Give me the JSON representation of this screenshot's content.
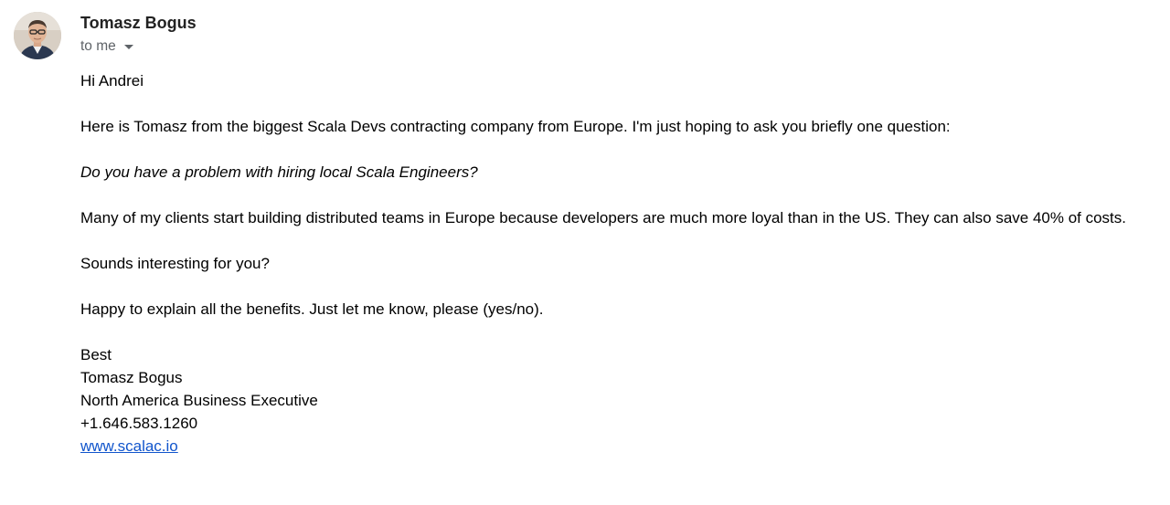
{
  "email": {
    "sender": {
      "name": "Tomasz Bogus",
      "avatar_icon": "person-avatar-icon"
    },
    "recipient_label": "to me",
    "body": {
      "greeting": "Hi Andrei",
      "intro": "Here is Tomasz from the biggest Scala Devs contracting company from Europe. I'm just hoping to ask you briefly one question:",
      "question": "Do you have a problem with hiring local Scala Engineers?",
      "pitch": "Many of my clients start building distributed teams in Europe because developers are much more loyal than in the US. They can also save 40% of costs.",
      "followup": "Sounds interesting for you?",
      "cta": "Happy to explain all the benefits. Just let me know, please (yes/no)."
    },
    "signature": {
      "closing": "Best",
      "name": "Tomasz Bogus",
      "title": "North America Business Executive",
      "phone": "+1.646.583.1260",
      "website": "www.scalac.io"
    }
  },
  "colors": {
    "link": "#1155cc",
    "secondary_text": "#5f6368",
    "sender_text": "#222222"
  }
}
